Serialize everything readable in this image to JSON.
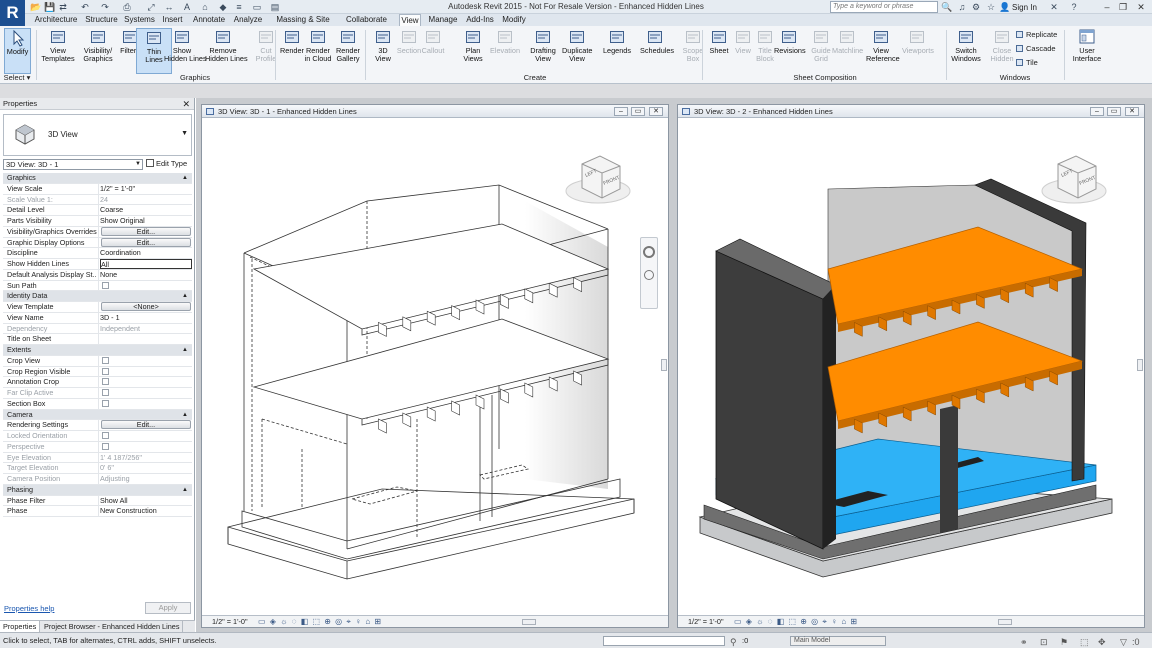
{
  "app": {
    "logo": "R",
    "title": "Autodesk Revit 2015 - Not For Resale Version -   Enhanced Hidden Lines",
    "search_placeholder": "Type a keyword or phrase",
    "signin": "Sign In",
    "minimize": "–",
    "restore": "❐",
    "close": "✕"
  },
  "tabs": [
    "Architecture",
    "Structure",
    "Systems",
    "Insert",
    "Annotate",
    "Analyze",
    "Massing & Site",
    "Collaborate",
    "View",
    "Manage",
    "Add-Ins",
    "Modify"
  ],
  "active_tab": "View",
  "ribbon": {
    "modify": "Modify",
    "select_label": "Select ▾",
    "graphics": [
      {
        "label": "View\nTemplates",
        "icon": "view-templates-icon",
        "enabled": true
      },
      {
        "label": "Visibility/\nGraphics",
        "icon": "visibility-graphics-icon",
        "enabled": true
      },
      {
        "label": "Filters",
        "icon": "filters-icon",
        "enabled": true
      },
      {
        "label": "Thin\nLines",
        "icon": "thin-lines-icon",
        "enabled": true,
        "selected": true
      },
      {
        "label": "Show\nHidden Lines",
        "icon": "show-hidden-lines-icon",
        "enabled": true
      },
      {
        "label": "Remove\nHidden Lines",
        "icon": "remove-hidden-lines-icon",
        "enabled": true
      },
      {
        "label": "Cut\nProfile",
        "icon": "cut-profile-icon",
        "enabled": false
      }
    ],
    "graphics_panel": "Graphics",
    "render": [
      {
        "label": "Render",
        "icon": "render-icon",
        "enabled": true
      },
      {
        "label": "Render\nin Cloud",
        "icon": "render-cloud-icon",
        "enabled": true
      },
      {
        "label": "Render\nGallery",
        "icon": "render-gallery-icon",
        "enabled": true
      }
    ],
    "create": [
      {
        "label": "3D\nView",
        "icon": "3d-view-icon",
        "enabled": true
      },
      {
        "label": "Section",
        "icon": "section-icon",
        "enabled": false
      },
      {
        "label": "Callout",
        "icon": "callout-icon",
        "enabled": false
      },
      {
        "label": "Plan\nViews",
        "icon": "plan-views-icon",
        "enabled": true
      },
      {
        "label": "Elevation",
        "icon": "elevation-icon",
        "enabled": false
      },
      {
        "label": "Drafting\nView",
        "icon": "drafting-view-icon",
        "enabled": true
      },
      {
        "label": "Duplicate\nView",
        "icon": "duplicate-view-icon",
        "enabled": true
      },
      {
        "label": "Legends",
        "icon": "legends-icon",
        "enabled": true
      },
      {
        "label": "Schedules",
        "icon": "schedules-icon",
        "enabled": true
      },
      {
        "label": "Scope\nBox",
        "icon": "scope-box-icon",
        "enabled": false
      }
    ],
    "create_panel": "Create",
    "sheet": [
      {
        "label": "Sheet",
        "icon": "sheet-icon",
        "enabled": true
      },
      {
        "label": "View",
        "icon": "view-icon",
        "enabled": false
      },
      {
        "label": "Title\nBlock",
        "icon": "title-block-icon",
        "enabled": false
      },
      {
        "label": "Revisions",
        "icon": "revisions-icon",
        "enabled": true
      },
      {
        "label": "Guide\nGrid",
        "icon": "guide-grid-icon",
        "enabled": false
      },
      {
        "label": "Matchline",
        "icon": "matchline-icon",
        "enabled": false
      },
      {
        "label": "View\nReference",
        "icon": "view-reference-icon",
        "enabled": true
      },
      {
        "label": "Viewports",
        "icon": "viewports-icon",
        "enabled": false
      }
    ],
    "sheet_panel": "Sheet Composition",
    "windows": [
      {
        "label": "Switch\nWindows",
        "icon": "switch-windows-icon",
        "enabled": true
      },
      {
        "label": "Close\nHidden",
        "icon": "close-hidden-icon",
        "enabled": false
      }
    ],
    "windows_small": [
      "Replicate",
      "Cascade",
      "Tile"
    ],
    "windows_panel": "Windows",
    "user_interface": "User\nInterface"
  },
  "properties": {
    "title": "Properties",
    "type_name": "3D View",
    "view_select": "3D View: 3D - 1",
    "edit_type": "Edit Type",
    "rows": [
      {
        "kind": "section",
        "name": "Graphics"
      },
      {
        "name": "View Scale",
        "value": "1/2\" = 1'-0\""
      },
      {
        "name": "Scale Value    1:",
        "value": "24",
        "dim": true
      },
      {
        "name": "Detail Level",
        "value": "Coarse"
      },
      {
        "name": "Parts Visibility",
        "value": "Show Original"
      },
      {
        "name": "Visibility/Graphics Overrides",
        "value": "Edit...",
        "button": true
      },
      {
        "name": "Graphic Display Options",
        "value": "Edit...",
        "button": true
      },
      {
        "name": "Discipline",
        "value": "Coordination"
      },
      {
        "name": "Show Hidden Lines",
        "value": "All",
        "boxed": true
      },
      {
        "name": "Default Analysis Display St...",
        "value": "None"
      },
      {
        "name": "Sun Path",
        "value": "",
        "checkbox": true
      },
      {
        "kind": "section",
        "name": "Identity Data"
      },
      {
        "name": "View Template",
        "value": "<None>",
        "button": true
      },
      {
        "name": "View Name",
        "value": "3D - 1"
      },
      {
        "name": "Dependency",
        "value": "Independent",
        "dim": true
      },
      {
        "name": "Title on Sheet",
        "value": ""
      },
      {
        "kind": "section",
        "name": "Extents"
      },
      {
        "name": "Crop View",
        "value": "",
        "checkbox": true
      },
      {
        "name": "Crop Region Visible",
        "value": "",
        "checkbox": true
      },
      {
        "name": "Annotation Crop",
        "value": "",
        "checkbox": true
      },
      {
        "name": "Far Clip Active",
        "value": "",
        "checkbox": true,
        "dim": true
      },
      {
        "name": "Section Box",
        "value": "",
        "checkbox": true
      },
      {
        "kind": "section",
        "name": "Camera"
      },
      {
        "name": "Rendering Settings",
        "value": "Edit...",
        "button": true
      },
      {
        "name": "Locked Orientation",
        "value": "",
        "checkbox": true,
        "dim": true
      },
      {
        "name": "Perspective",
        "value": "",
        "checkbox": true,
        "dim": true
      },
      {
        "name": "Eye Elevation",
        "value": "1'  4 187/256\"",
        "dim": true
      },
      {
        "name": "Target Elevation",
        "value": "0'  6\"",
        "dim": true
      },
      {
        "name": "Camera Position",
        "value": "Adjusting",
        "dim": true
      },
      {
        "kind": "section",
        "name": "Phasing"
      },
      {
        "name": "Phase Filter",
        "value": "Show All"
      },
      {
        "name": "Phase",
        "value": "New Construction"
      }
    ],
    "help": "Properties help",
    "apply": "Apply"
  },
  "bottom_tabs": [
    "Properties",
    "Project Browser - Enhanced Hidden Lines"
  ],
  "views": [
    {
      "title": "3D View: 3D - 1 - Enhanced Hidden Lines",
      "scale": "1/2\" = 1'-0\"",
      "style": "hidden-lines"
    },
    {
      "title": "3D View: 3D - 2 - Enhanced Hidden Lines",
      "scale": "1/2\" = 1'-0\"",
      "style": "shaded"
    }
  ],
  "viewcube": {
    "top": "LEFT",
    "front": "FRONT"
  },
  "colors": {
    "orange": "#ff8c00",
    "blue": "#1fa6f0",
    "dark": "#3d3d3d",
    "gray": "#b9bbbd",
    "accent": "#1d4f91"
  },
  "status": {
    "text": "Click to select, TAB for alternates, CTRL adds, SHIFT unselects.",
    "zero": ":0",
    "model": "Main Model"
  }
}
